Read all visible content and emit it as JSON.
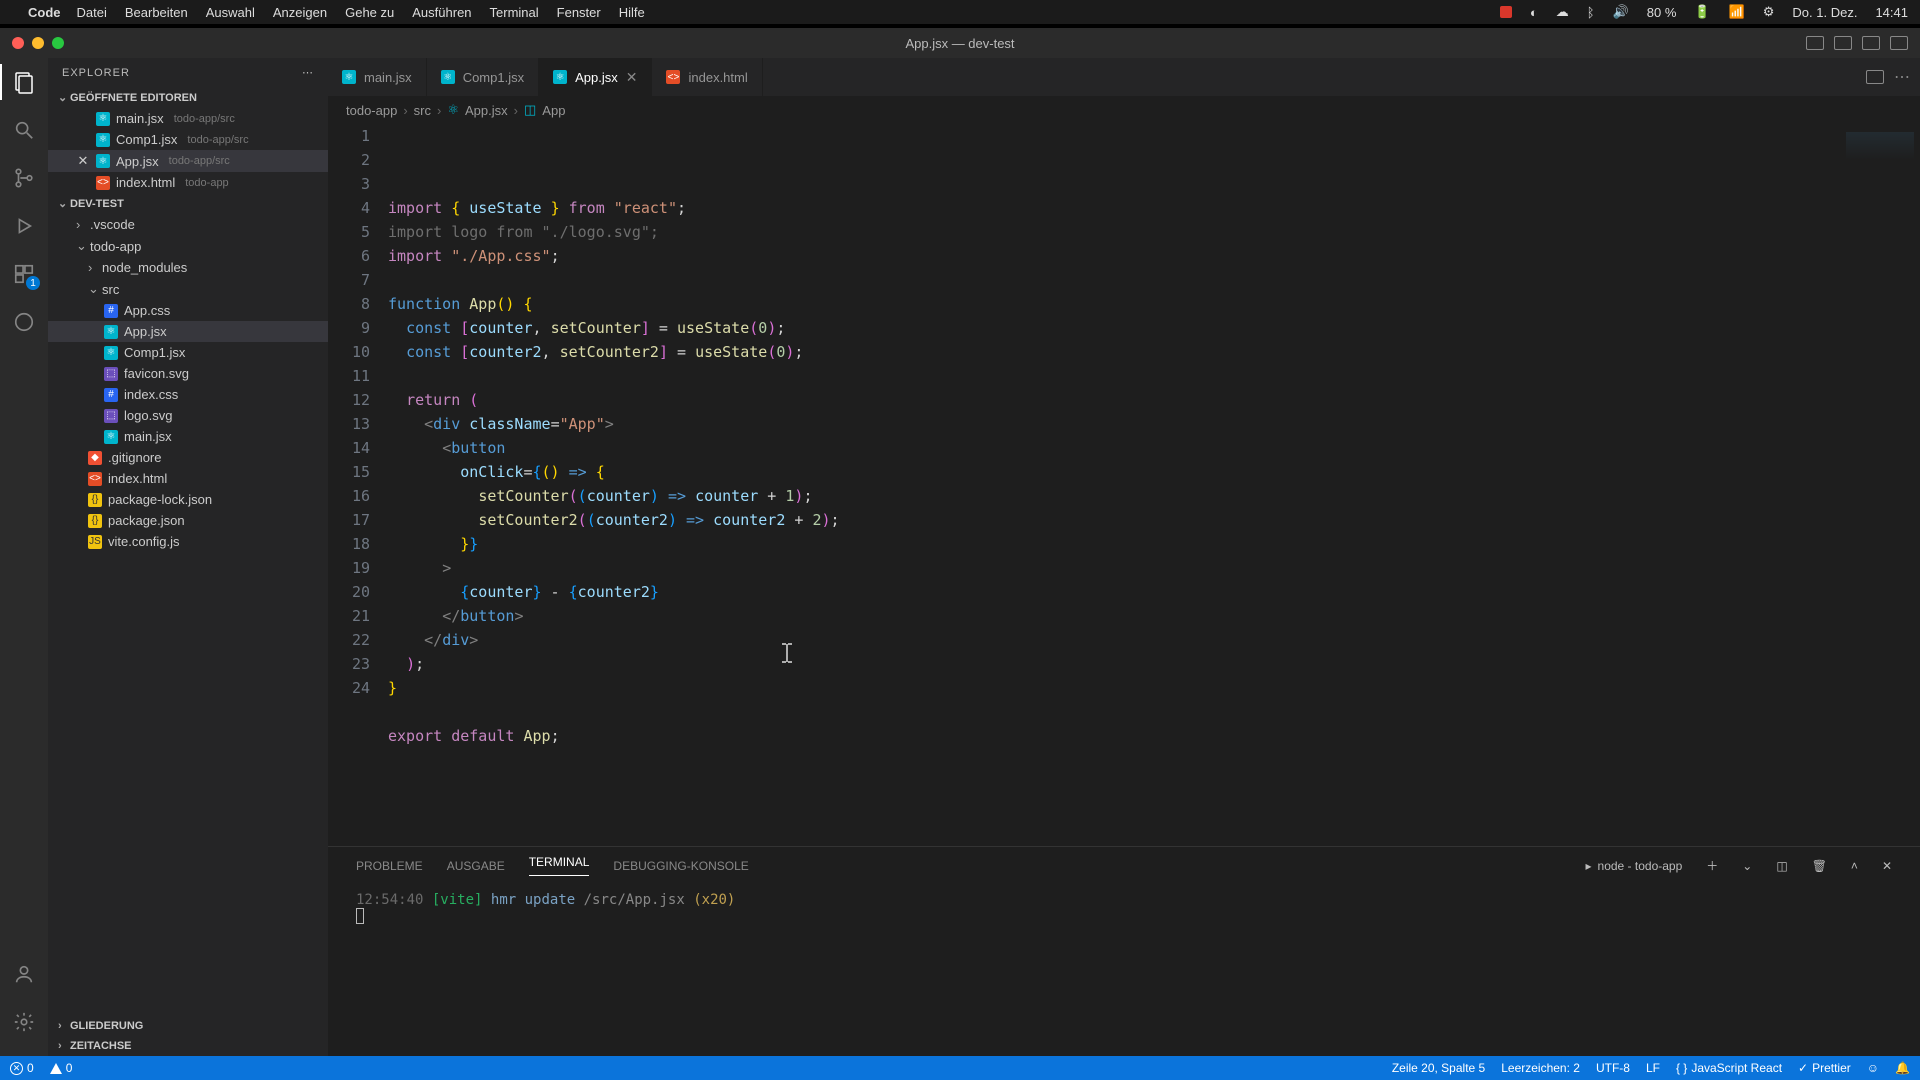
{
  "menubar": {
    "app": "Code",
    "items": [
      "Datei",
      "Bearbeiten",
      "Auswahl",
      "Anzeigen",
      "Gehe zu",
      "Ausführen",
      "Terminal",
      "Fenster",
      "Hilfe"
    ],
    "right": {
      "battery": "80 %",
      "date": "Do. 1. Dez.",
      "time": "14:41"
    }
  },
  "window": {
    "title": "App.jsx — dev-test"
  },
  "sidebar": {
    "title": "EXPLORER",
    "open_editors_label": "GEÖFFNETE EDITOREN",
    "open_editors": [
      {
        "name": "main.jsx",
        "path": "todo-app/src",
        "icon": "jsx"
      },
      {
        "name": "Comp1.jsx",
        "path": "todo-app/src",
        "icon": "jsx"
      },
      {
        "name": "App.jsx",
        "path": "todo-app/src",
        "icon": "jsx",
        "active": true
      },
      {
        "name": "index.html",
        "path": "todo-app",
        "icon": "html"
      }
    ],
    "project": "DEV-TEST",
    "tree": {
      "vscode": ".vscode",
      "todo_app": "todo-app",
      "node_modules": "node_modules",
      "src": "src",
      "files": [
        {
          "name": "App.css",
          "icon": "css"
        },
        {
          "name": "App.jsx",
          "icon": "jsx",
          "active": true
        },
        {
          "name": "Comp1.jsx",
          "icon": "jsx"
        },
        {
          "name": "favicon.svg",
          "icon": "svg"
        },
        {
          "name": "index.css",
          "icon": "css"
        },
        {
          "name": "logo.svg",
          "icon": "svg"
        },
        {
          "name": "main.jsx",
          "icon": "jsx"
        }
      ],
      "root_files": [
        {
          "name": ".gitignore",
          "icon": "git"
        },
        {
          "name": "index.html",
          "icon": "html"
        },
        {
          "name": "package-lock.json",
          "icon": "json"
        },
        {
          "name": "package.json",
          "icon": "json"
        },
        {
          "name": "vite.config.js",
          "icon": "js"
        }
      ]
    },
    "outline": "GLIEDERUNG",
    "timeline": "ZEITACHSE"
  },
  "activity": {
    "badge": "1"
  },
  "tabs": [
    {
      "name": "main.jsx",
      "icon": "jsx"
    },
    {
      "name": "Comp1.jsx",
      "icon": "jsx"
    },
    {
      "name": "App.jsx",
      "icon": "jsx",
      "active": true
    },
    {
      "name": "index.html",
      "icon": "html"
    }
  ],
  "breadcrumb": [
    "todo-app",
    "src",
    "App.jsx",
    "App"
  ],
  "code": {
    "line_count": 24,
    "lines": [
      {
        "n": 1,
        "html": "<span class='k-purple'>import</span> <span class='k-brace'>{</span> <span class='k-lblue'>useState</span> <span class='k-brace'>}</span> <span class='k-purple'>from</span> <span class='k-string'>\"react\"</span>;"
      },
      {
        "n": 2,
        "html": "<span class='k-dim'>import</span> <span class='k-dim'>logo</span> <span class='k-dim'>from</span> <span class='k-dim'>\"./logo.svg\"</span><span class='k-dim'>;</span>"
      },
      {
        "n": 3,
        "html": "<span class='k-purple'>import</span> <span class='k-string'>\"./App.css\"</span>;"
      },
      {
        "n": 4,
        "html": ""
      },
      {
        "n": 5,
        "html": "<span class='k-blue'>function</span> <span class='k-yellow'>App</span><span class='k-brace'>()</span> <span class='k-brace'>{</span>"
      },
      {
        "n": 6,
        "html": "  <span class='k-blue'>const</span> <span class='k-brace2'>[</span><span class='k-lblue'>counter</span>, <span class='k-yellow'>setCounter</span><span class='k-brace2'>]</span> = <span class='k-yellow'>useState</span><span class='k-brace2'>(</span><span class='k-num'>0</span><span class='k-brace2'>)</span>;"
      },
      {
        "n": 7,
        "html": "  <span class='k-blue'>const</span> <span class='k-brace2'>[</span><span class='k-lblue'>counter2</span>, <span class='k-yellow'>setCounter2</span><span class='k-brace2'>]</span> = <span class='k-yellow'>useState</span><span class='k-brace2'>(</span><span class='k-num'>0</span><span class='k-brace2'>)</span>;"
      },
      {
        "n": 8,
        "html": ""
      },
      {
        "n": 9,
        "html": "  <span class='k-purple'>return</span> <span class='k-brace2'>(</span>"
      },
      {
        "n": 10,
        "html": "    <span class='k-gray'>&lt;</span><span class='k-tag'>div</span> <span class='k-lblue'>className</span>=<span class='k-string'>\"App\"</span><span class='k-gray'>&gt;</span>"
      },
      {
        "n": 11,
        "html": "      <span class='k-gray'>&lt;</span><span class='k-tag'>button</span>"
      },
      {
        "n": 12,
        "html": "        <span class='k-lblue'>onClick</span>=<span class='k-brace3'>{</span><span class='k-brace'>()</span> <span class='k-blue'>=&gt;</span> <span class='k-brace'>{</span>"
      },
      {
        "n": 13,
        "html": "          <span class='k-yellow'>setCounter</span><span class='k-brace2'>(</span><span class='k-brace3'>(</span><span class='k-lblue'>counter</span><span class='k-brace3'>)</span> <span class='k-blue'>=&gt;</span> <span class='k-lblue'>counter</span> + <span class='k-num'>1</span><span class='k-brace2'>)</span>;"
      },
      {
        "n": 14,
        "html": "          <span class='k-yellow'>setCounter2</span><span class='k-brace2'>(</span><span class='k-brace3'>(</span><span class='k-lblue'>counter2</span><span class='k-brace3'>)</span> <span class='k-blue'>=&gt;</span> <span class='k-lblue'>counter2</span> + <span class='k-num'>2</span><span class='k-brace2'>)</span>;"
      },
      {
        "n": 15,
        "html": "        <span class='k-brace'>}</span><span class='k-brace3'>}</span>"
      },
      {
        "n": 16,
        "html": "      <span class='k-gray'>&gt;</span>"
      },
      {
        "n": 17,
        "html": "        <span class='k-brace3'>{</span><span class='k-lblue'>counter</span><span class='k-brace3'>}</span> - <span class='k-brace3'>{</span><span class='k-lblue'>counter2</span><span class='k-brace3'>}</span>"
      },
      {
        "n": 18,
        "html": "      <span class='k-gray'>&lt;/</span><span class='k-tag'>button</span><span class='k-gray'>&gt;</span>"
      },
      {
        "n": 19,
        "html": "    <span class='k-gray'>&lt;/</span><span class='k-tag'>div</span><span class='k-gray'>&gt;</span>"
      },
      {
        "n": 20,
        "html": "  <span class='k-brace2'>)</span>;"
      },
      {
        "n": 21,
        "html": "<span class='k-brace'>}</span>"
      },
      {
        "n": 22,
        "html": ""
      },
      {
        "n": 23,
        "html": "<span class='k-purple'>export</span> <span class='k-purple'>default</span> <span class='k-yellow'>App</span>;"
      },
      {
        "n": 24,
        "html": ""
      }
    ]
  },
  "panel": {
    "tabs": [
      "PROBLEME",
      "AUSGABE",
      "TERMINAL",
      "DEBUGGING-KONSOLE"
    ],
    "active_tab": "TERMINAL",
    "shell": "node - todo-app",
    "term_ts": "12:54:40",
    "term_tag": "[vite]",
    "term_msg": "hmr update",
    "term_path": "/src/App.jsx",
    "term_count": "(x20)"
  },
  "status": {
    "errors": "0",
    "warnings": "0",
    "cursor": "Zeile 20, Spalte 5",
    "spaces": "Leerzeichen: 2",
    "encoding": "UTF-8",
    "eol": "LF",
    "lang": "JavaScript React",
    "prettier": "Prettier"
  }
}
